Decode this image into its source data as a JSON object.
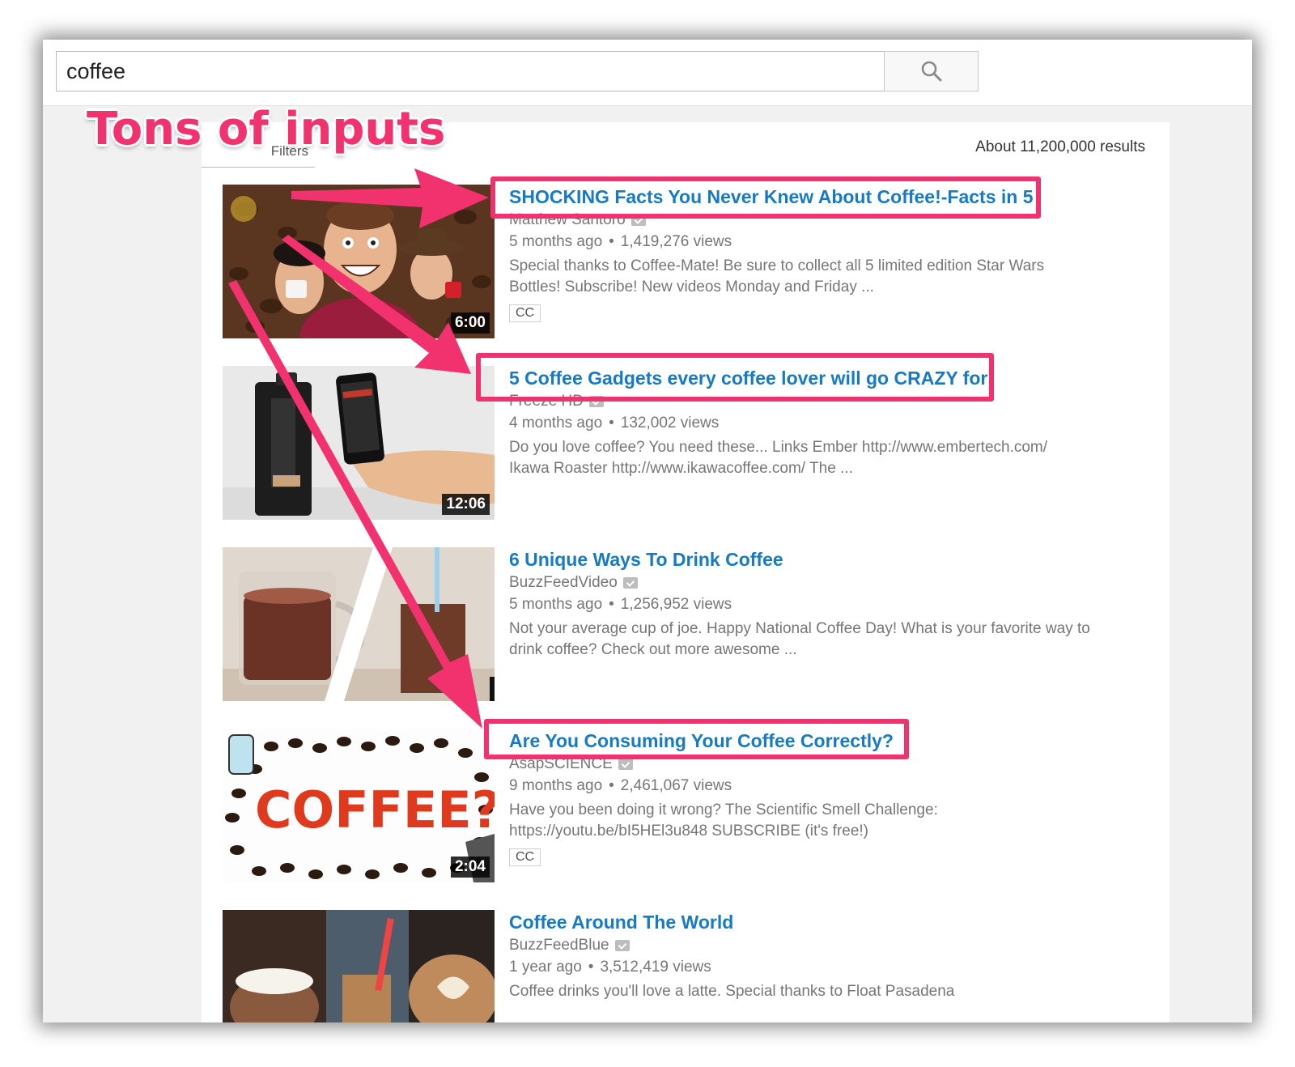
{
  "search": {
    "value": "coffee",
    "button_icon": "search-icon"
  },
  "filters": {
    "label": "Filters"
  },
  "result_count": "About 11,200,000 results",
  "annotation": {
    "heading": "Tons of inputs",
    "color": "#f2316f"
  },
  "videos": [
    {
      "title": "SHOCKING Facts You Never Knew About Coffee!-Facts in 5",
      "channel": "Matthew Santoro",
      "age": "5 months ago",
      "views": "1,419,276 views",
      "desc1": "Special thanks to Coffee-Mate! Be sure to collect all 5 limited edition Star Wars",
      "desc2": "Bottles! Subscribe! New videos Monday and Friday ...",
      "badge": "CC",
      "duration": "6:00"
    },
    {
      "title": "5 Coffee Gadgets every coffee lover will go CRAZY for",
      "channel": "Freeze HD",
      "age": "4 months ago",
      "views": "132,002 views",
      "desc1": "Do you love coffee? You need these... Links Ember http://www.embertech.com/",
      "desc2": "Ikawa Roaster http://www.ikawacoffee.com/ The ...",
      "duration": "12:06"
    },
    {
      "title": "6 Unique Ways To Drink Coffee",
      "channel": "BuzzFeedVideo",
      "age": "5 months ago",
      "views": "1,256,952 views",
      "desc1": "Not your average cup of joe. Happy National Coffee Day! What is your favorite way to",
      "desc2": "drink coffee? Check out more awesome ..."
    },
    {
      "title": "Are You Consuming Your Coffee Correctly?",
      "channel": "AsapSCIENCE",
      "age": "9 months ago",
      "views": "2,461,067 views",
      "desc1": "Have you been doing it wrong? The Scientific Smell Challenge:",
      "desc2": "https://youtu.be/bI5HEl3u848 SUBSCRIBE (it's free!)",
      "badge": "CC",
      "duration": "2:04",
      "thumb_text": "COFFEE?"
    },
    {
      "title": "Coffee Around The World",
      "channel": "BuzzFeedBlue",
      "age": "1 year ago",
      "views": "3,512,419 views",
      "desc1": "Coffee drinks you'll love a latte. Special thanks to Float Pasadena"
    }
  ]
}
